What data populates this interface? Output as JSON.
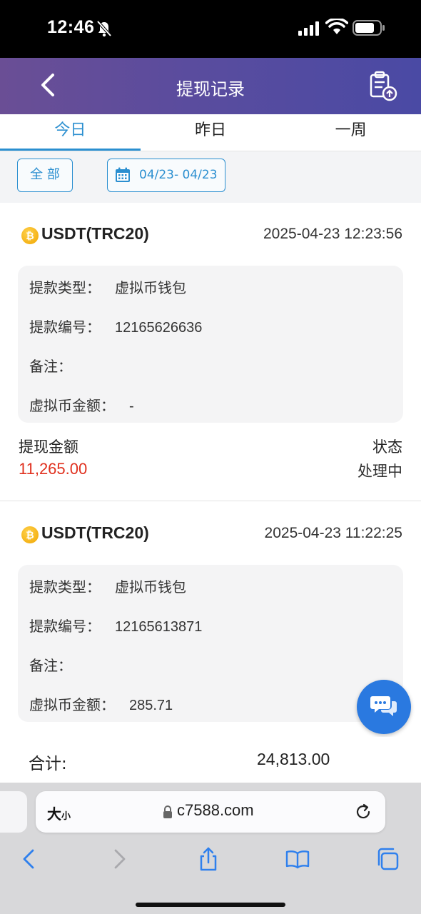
{
  "status_bar": {
    "time": "12:46"
  },
  "header": {
    "title": "提现记录"
  },
  "tabs": [
    {
      "label": "今日",
      "active": true
    },
    {
      "label": "昨日",
      "active": false
    },
    {
      "label": "一周",
      "active": false
    }
  ],
  "filters": {
    "all_label": "全 部",
    "date_range": "04/23- 04/23"
  },
  "records": [
    {
      "coin": "USDT(TRC20)",
      "coin_icon": "bitcoin-icon",
      "time": "2025-04-23 12:23:56",
      "type_label": "提款类型：",
      "type_value": "虚拟币钱包",
      "number_label": "提款编号：",
      "number_value": "12165626636",
      "remark_label": "备注：",
      "remark_value": "",
      "crypto_amount_label": "虚拟币金额：",
      "crypto_amount_value": "-",
      "amount_label": "提现金额",
      "amount_value": "11,265.00",
      "status_label": "状态",
      "status_value": "处理中"
    },
    {
      "coin": "USDT(TRC20)",
      "coin_icon": "bitcoin-icon",
      "time": "2025-04-23 11:22:25",
      "type_label": "提款类型：",
      "type_value": "虚拟币钱包",
      "number_label": "提款编号：",
      "number_value": "12165613871",
      "remark_label": "备注：",
      "remark_value": "",
      "crypto_amount_label": "虚拟币金额：",
      "crypto_amount_value": "285.71"
    }
  ],
  "total": {
    "label": "合计:",
    "value": "24,813.00"
  },
  "browser": {
    "text_size_label": "大",
    "text_size_small": "小",
    "url": "c7588.com"
  },
  "colors": {
    "accent": "#2b8fd0",
    "amount": "#e0301e",
    "header_start": "#6a4e95",
    "header_end": "#4a4aa4",
    "fab": "#2a79e0"
  }
}
